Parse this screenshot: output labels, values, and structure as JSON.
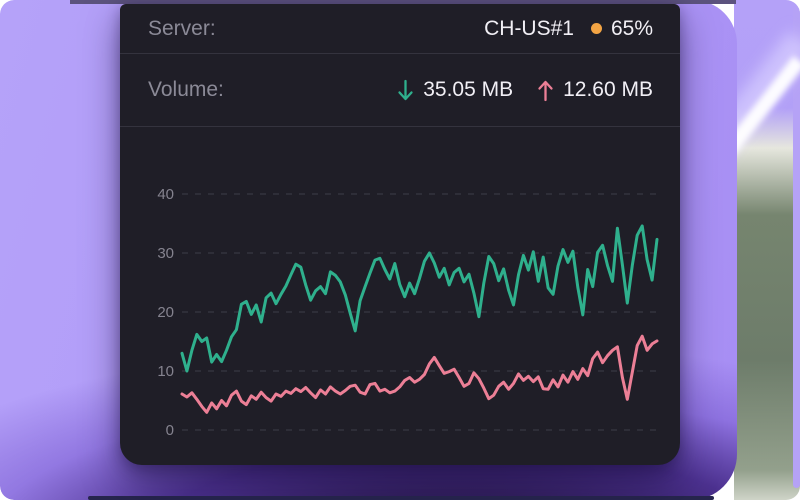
{
  "card": {
    "server_row": {
      "label": "Server:",
      "server_name": "CH-US#1",
      "load_percent": "65%",
      "dot_color": "#f2a444"
    },
    "volume_row": {
      "label": "Volume:",
      "download_value": "35.05 MB",
      "upload_value": "12.60 MB",
      "download_color": "#2fb08d",
      "upload_color": "#ec7f96"
    }
  },
  "chart_data": {
    "type": "line",
    "title": "",
    "xlabel": "",
    "ylabel": "",
    "ylim": [
      0,
      40
    ],
    "yticks": [
      0,
      10,
      20,
      30,
      40
    ],
    "grid": "horizontal dashed lines at each y tick",
    "legend_position": "none",
    "x": "unlabeled time samples, 97 points",
    "tick_color": "#85838f",
    "grid_color": "#3e3d49",
    "series": [
      {
        "name": "download",
        "color": "#2fb08d",
        "values": [
          13.0,
          10.0,
          13.5,
          16.2,
          15.0,
          15.6,
          11.5,
          12.8,
          11.6,
          13.5,
          15.8,
          17.0,
          21.3,
          21.8,
          19.6,
          21.2,
          18.3,
          22.4,
          23.2,
          21.4,
          23.0,
          24.4,
          26.3,
          28.1,
          27.6,
          24.6,
          22.0,
          23.6,
          24.3,
          23.1,
          26.8,
          26.2,
          25.1,
          22.9,
          19.8,
          16.8,
          21.9,
          24.3,
          26.6,
          28.8,
          29.1,
          27.2,
          25.6,
          28.2,
          24.7,
          22.6,
          24.9,
          23.1,
          25.7,
          28.6,
          30.0,
          28.3,
          25.9,
          27.4,
          24.6,
          26.7,
          27.4,
          25.1,
          26.4,
          23.2,
          19.2,
          24.9,
          29.4,
          28.2,
          25.3,
          27.3,
          23.7,
          21.2,
          26.3,
          29.6,
          27.1,
          30.2,
          25.2,
          29.3,
          24.1,
          23.0,
          27.8,
          30.6,
          28.4,
          30.3,
          24.2,
          19.5,
          27.2,
          24.3,
          30.1,
          31.3,
          27.9,
          25.2,
          34.2,
          28.0,
          21.5,
          27.9,
          33.0,
          34.6,
          28.9,
          25.4,
          32.3
        ]
      },
      {
        "name": "upload",
        "color": "#ec7f96",
        "values": [
          6.1,
          5.6,
          6.3,
          5.2,
          4.0,
          3.0,
          4.6,
          3.6,
          5.0,
          4.1,
          5.9,
          6.6,
          4.9,
          4.3,
          5.8,
          5.2,
          6.4,
          5.5,
          4.9,
          6.1,
          5.7,
          6.6,
          6.2,
          7.0,
          6.5,
          7.2,
          6.3,
          5.5,
          6.8,
          6.1,
          7.3,
          6.6,
          6.1,
          6.7,
          7.4,
          7.6,
          6.4,
          6.1,
          7.7,
          7.9,
          6.6,
          6.9,
          6.3,
          6.6,
          7.3,
          8.4,
          8.9,
          8.1,
          8.6,
          9.4,
          11.2,
          12.3,
          10.9,
          9.6,
          9.9,
          10.3,
          8.9,
          7.4,
          7.9,
          9.7,
          8.7,
          7.1,
          5.3,
          5.9,
          7.4,
          8.1,
          6.9,
          7.9,
          9.5,
          8.4,
          9.1,
          8.2,
          9.0,
          7.0,
          6.9,
          8.5,
          7.3,
          9.3,
          8.1,
          9.9,
          8.6,
          10.4,
          9.2,
          12.1,
          13.2,
          11.4,
          12.6,
          13.5,
          14.1,
          8.9,
          5.2,
          9.8,
          14.3,
          15.9,
          13.5,
          14.6,
          15.1
        ]
      }
    ]
  }
}
